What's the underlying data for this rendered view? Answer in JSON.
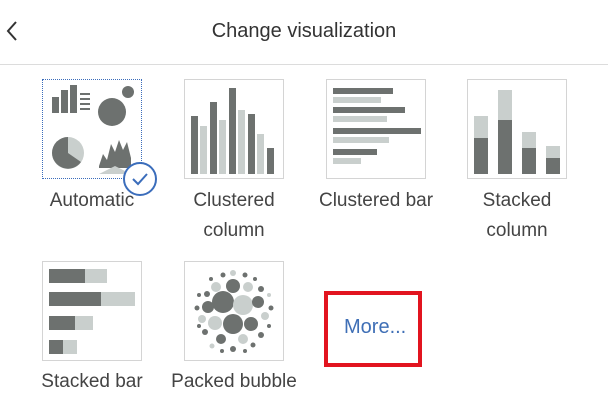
{
  "header": {
    "title": "Change visualization",
    "back_icon": "chevron-left-icon"
  },
  "options": [
    {
      "id": "automatic",
      "label_lines": [
        "Automatic"
      ],
      "selected": true
    },
    {
      "id": "clustered-column",
      "label_lines": [
        "Clustered",
        "column"
      ]
    },
    {
      "id": "clustered-bar",
      "label_lines": [
        "Clustered bar"
      ]
    },
    {
      "id": "stacked-column",
      "label_lines": [
        "Stacked",
        "column"
      ]
    },
    {
      "id": "stacked-bar",
      "label_lines": [
        "Stacked bar"
      ]
    },
    {
      "id": "packed-bubble",
      "label_lines": [
        "Packed bubble"
      ]
    }
  ],
  "more": {
    "label": "More..."
  },
  "colors": {
    "dark": "#6d716f",
    "light": "#c9cfcd",
    "accent": "#3b6dbb",
    "highlight": "#e2141f"
  }
}
